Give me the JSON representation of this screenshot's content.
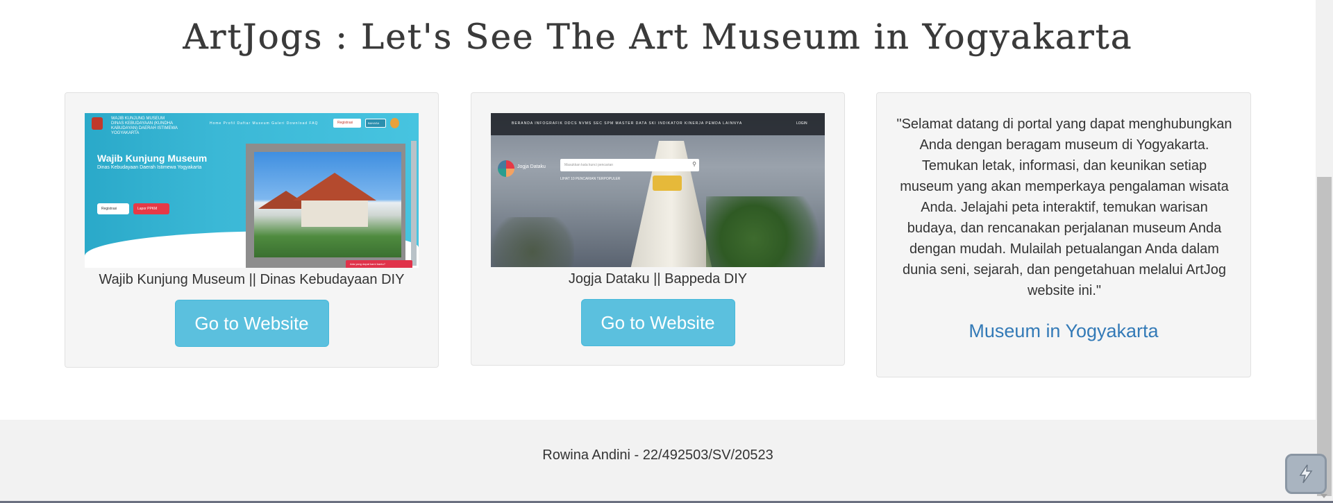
{
  "page": {
    "title": "ArtJogs : Let's See The Art Museum in Yogyakarta"
  },
  "cards": [
    {
      "caption": "Wajib Kunjung Museum || Dinas Kebudayaan DIY",
      "button_label": "Go to Website",
      "screenshot": {
        "heading": "Wajib Kunjung Museum",
        "subheading": "Dinas Kebudayaan Daerah Istimewa Yogyakarta",
        "header_brand": "WAJIB KUNJUNG MUSEUM",
        "header_sub": "DINAS KEBUDAYAAN (KUNDHA KABUDAYAN) DAERAH ISTIMEWA YOGYAKARTA",
        "nav": "Home   Profil   Daftar Museum   Galeri   Download   FAQ",
        "login_label": "Registrasi",
        "lang_label": "BAHASA",
        "button_1": "Registrasi",
        "button_2": "Lapor PPKM",
        "whatsapp_label": "Ada yang dapat kami bantu?"
      }
    },
    {
      "caption": "Jogja Dataku || Bappeda DIY",
      "button_label": "Go to Website",
      "screenshot": {
        "nav": "BERANDA   INFOGRAFIK   DDCS   NVMS   SEC   SPM   MASTER DATA   SKI   INDIKATOR KINERJA PEMDA   LAINNYA",
        "login_label": "LOGIN",
        "logo_text": "Jogja Dataku",
        "search_placeholder": "Masukkan kata kunci pencarian",
        "subtext": "LIHAT 10 PENCARIAN TERPOPULER"
      }
    }
  ],
  "info_card": {
    "quote": "\"Selamat datang di portal yang dapat menghubungkan Anda dengan beragam museum di Yogyakarta. Temukan letak, informasi, dan keunikan setiap museum yang akan memperkaya pengalaman wisata Anda. Jelajahi peta interaktif, temukan warisan budaya, dan rencanakan perjalanan museum Anda dengan mudah. Mulailah petualangan Anda dalam dunia seni, sejarah, dan pengetahuan melalui ArtJog website ini.\"",
    "link_label": "Museum in Yogyakarta"
  },
  "footer": {
    "text": "Rowina Andini - 22/492503/SV/20523"
  },
  "colors": {
    "button_bg": "#5bc0de",
    "link": "#337ab7",
    "card_bg": "#f5f5f5",
    "footer_bg": "#f2f2f2"
  }
}
